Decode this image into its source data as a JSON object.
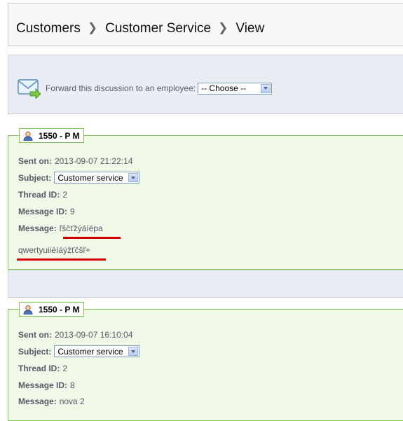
{
  "breadcrumb": [
    "Customers",
    "Customer Service",
    "View"
  ],
  "forward": {
    "label": "Forward this discussion to an employee:",
    "select_value": "-- Choose --",
    "icon": "envelope-forward-icon"
  },
  "labels": {
    "sent_on": "Sent on:",
    "subject": "Subject:",
    "thread_id": "Thread ID:",
    "message_id": "Message ID:",
    "message": "Message:"
  },
  "messages": [
    {
      "author": "1550 - P M",
      "sent_on": "2013-09-07 21:22:14",
      "subject": "Customer service",
      "thread_id": "2",
      "message_id": "9",
      "message": "ľščťžýáíépa",
      "message_body": "qwertyuiiéíáýžťčšľ+"
    },
    {
      "author": "1550 - P M",
      "sent_on": "2013-09-07 16:10:04",
      "subject": "Customer service",
      "thread_id": "2",
      "message_id": "8",
      "message": "nova 2"
    }
  ],
  "colors": {
    "panel_bg": "#f0f9e7",
    "panel_border": "#7fc851",
    "toolbar_bg": "#ebedf4",
    "highlight_underline": "#d40000"
  }
}
